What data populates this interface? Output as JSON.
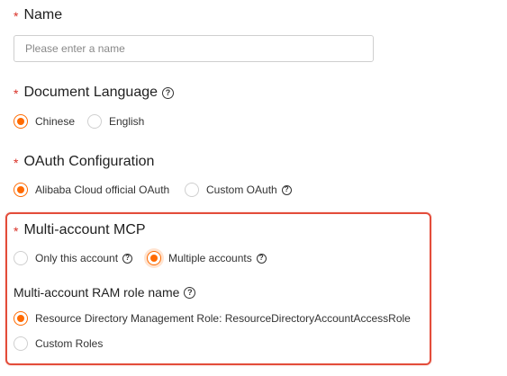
{
  "name": {
    "required_mark": "*",
    "label": "Name",
    "placeholder": "Please enter a name"
  },
  "doc_language": {
    "required_mark": "*",
    "label": "Document Language",
    "help_icon": "?",
    "options": [
      {
        "label": "Chinese",
        "selected": true
      },
      {
        "label": "English",
        "selected": false
      }
    ]
  },
  "oauth": {
    "required_mark": "*",
    "label": "OAuth Configuration",
    "options": [
      {
        "label": "Alibaba Cloud official OAuth",
        "selected": true
      },
      {
        "label": "Custom OAuth",
        "selected": false,
        "help_icon": "?"
      }
    ]
  },
  "multi_account": {
    "required_mark": "*",
    "label": "Multi-account MCP",
    "options": [
      {
        "label": "Only this account",
        "selected": false,
        "help_icon": "?"
      },
      {
        "label": "Multiple accounts",
        "selected": true,
        "help_icon": "?"
      }
    ],
    "ram_role": {
      "label": "Multi-account RAM role name",
      "help_icon": "?",
      "options": [
        {
          "label": "Resource Directory Management Role: ResourceDirectoryAccountAccessRole",
          "selected": true
        },
        {
          "label": "Custom Roles",
          "selected": false
        }
      ]
    }
  },
  "colors": {
    "accent": "#ff6a00",
    "required": "#d93026",
    "highlight_border": "#e34c3a"
  }
}
